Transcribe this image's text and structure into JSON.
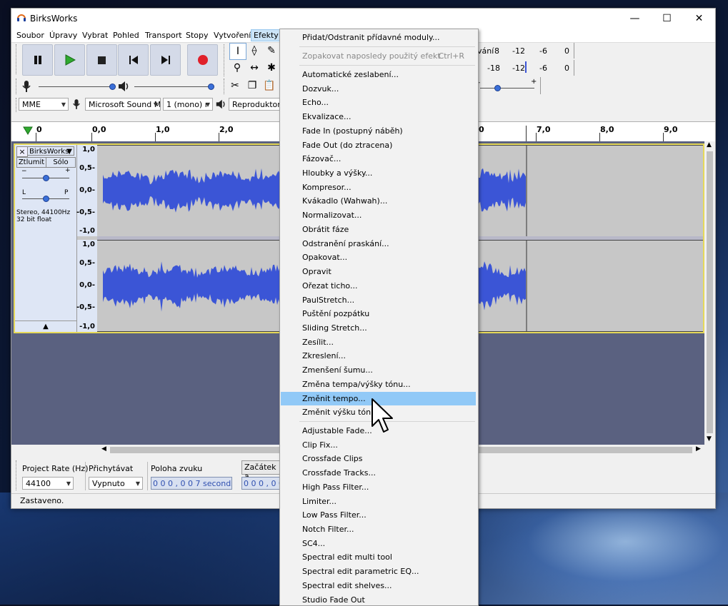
{
  "window": {
    "title": "BirksWorks",
    "minimize": "—",
    "maximize": "☐",
    "close": "✕"
  },
  "menubar": [
    "Soubor",
    "Úpravy",
    "Vybrat",
    "Pohled",
    "Transport",
    "Stopy",
    "Vytvoření",
    "Efekty"
  ],
  "meters": {
    "record_label": "vání",
    "record_ticks": [
      "8",
      "-12",
      "-6",
      "0"
    ],
    "play_ticks": [
      "-18",
      "-12",
      "-6",
      "0"
    ]
  },
  "device_toolbar": {
    "host": "MME",
    "input_device": "Microsoft Sound M",
    "channels": "1 (mono) r",
    "output_device": "Reproduktory"
  },
  "ruler": {
    "left_labels": [
      "0",
      "0,0",
      "1,0",
      "2,0"
    ],
    "right_labels": [
      "0",
      "7,0",
      "8,0",
      "9,0"
    ]
  },
  "track": {
    "name": "BirksWorks",
    "mute": "Ztlumit",
    "solo": "Sólo",
    "gain_minus": "−",
    "gain_plus": "+",
    "pan_left": "L",
    "pan_right": "P",
    "info_line1": "Stereo, 44100Hz",
    "info_line2": "32 bit float",
    "scale": [
      "1,0",
      "0,5-",
      "0,0-",
      "-0,5-",
      "-1,0"
    ]
  },
  "selection_toolbar": {
    "project_rate_label": "Project Rate (Hz)",
    "project_rate_value": "44100",
    "snap_label": "Přichytávat",
    "snap_value": "Vypnuto",
    "position_label": "Poloha zvuku",
    "position_value": "0 0 0 , 0 0 7 seconds",
    "start_label": "Začátek a",
    "start_value": "0 0 0 , 0 0 7"
  },
  "status": "Zastaveno.",
  "effects_menu": {
    "top_items": [
      {
        "label": "Přidat/Odstranit přídavné moduly...",
        "shortcut": "",
        "disabled": false
      },
      {
        "label": "Zopakovat naposledy použitý efekt",
        "shortcut": "Ctrl+R",
        "disabled": true
      }
    ],
    "builtin": [
      "Automatické zeslabení...",
      "Dozvuk...",
      "Echo...",
      "Ekvalizace...",
      "Fade In (postupný náběh)",
      "Fade Out (do ztracena)",
      "Fázovač...",
      "Hloubky a výšky...",
      "Kompresor...",
      "Kvákadlo (Wahwah)...",
      "Normalizovat...",
      "Obrátit fáze",
      "Odstranění praskání...",
      "Opakovat...",
      "Opravit",
      "Ořezat ticho...",
      "PaulStretch...",
      "Puštění pozpátku",
      "Sliding Stretch...",
      "Zesílit...",
      "Zkreslení...",
      "Zmenšení šumu...",
      "Změna tempa/výšky tónu...",
      "Změnit tempo...",
      "Změnit výšku tónu..."
    ],
    "highlighted": "Změnit tempo...",
    "plugins": [
      "Adjustable Fade...",
      "Clip Fix...",
      "Crossfade Clips",
      "Crossfade Tracks...",
      "High Pass Filter...",
      "Limiter...",
      "Low Pass Filter...",
      "Notch Filter...",
      "SC4...",
      "Spectral edit multi tool",
      "Spectral edit parametric EQ...",
      "Spectral edit shelves...",
      "Studio Fade Out"
    ]
  },
  "colors": {
    "accent_highlight": "#91c9f7",
    "waveform": "#3b55d6",
    "track_border": "#e6d95a",
    "record": "#e0202a",
    "play": "#2faa2f"
  }
}
